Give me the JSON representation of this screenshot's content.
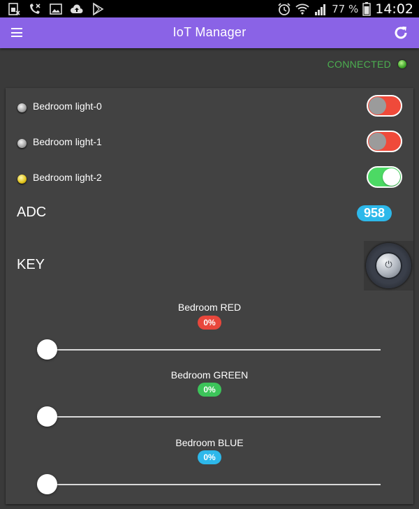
{
  "status_bar": {
    "icons_left": [
      "sim-card-icon",
      "missed-call-icon",
      "image-icon",
      "cloud-upload-icon",
      "play-store-icon"
    ],
    "icons_right": [
      "alarm-icon",
      "wifi-icon",
      "signal-icon"
    ],
    "battery_percent": "77 %",
    "time": "14:02"
  },
  "app_bar": {
    "title": "IoT Manager",
    "menu_icon": "menu-icon",
    "refresh_icon": "refresh-icon",
    "color": "#8a63e6"
  },
  "connection": {
    "status": "CONNECTED",
    "color": "#4caf50"
  },
  "lights": [
    {
      "label": "Bedroom light-0",
      "led": "off",
      "switch_on": false
    },
    {
      "label": "Bedroom light-1",
      "led": "off",
      "switch_on": false
    },
    {
      "label": "Bedroom light-2",
      "led": "on",
      "switch_on": true
    }
  ],
  "adc": {
    "label": "ADC",
    "value": "958"
  },
  "key": {
    "label": "KEY",
    "button_glyph": "⏻"
  },
  "sliders": [
    {
      "title": "Bedroom RED",
      "value": 0,
      "display": "0%",
      "badge_color": "#e8473c"
    },
    {
      "title": "Bedroom GREEN",
      "value": 0,
      "display": "0%",
      "badge_color": "#3cc45a"
    },
    {
      "title": "Bedroom BLUE",
      "value": 0,
      "display": "0%",
      "badge_color": "#2db8ea"
    }
  ]
}
